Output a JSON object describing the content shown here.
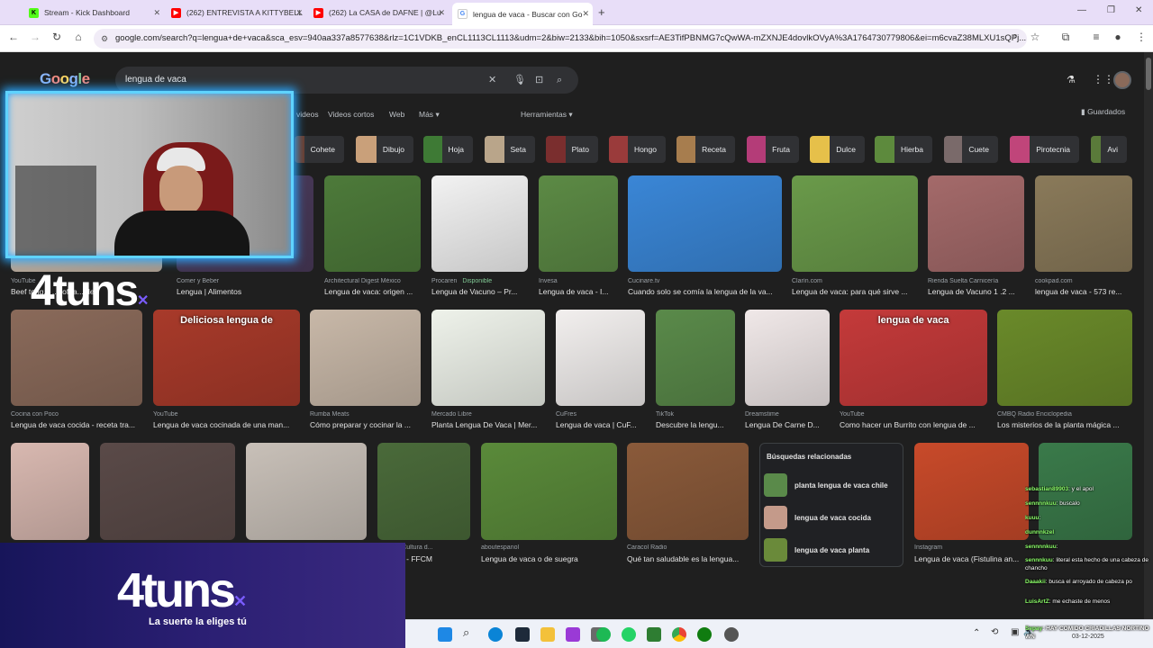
{
  "tabs": [
    {
      "label": "Stream - Kick Dashboard",
      "icon": "kick-icon",
      "color": "#53fc18"
    },
    {
      "label": "(262) ENTREVISTA A KITTYBELL",
      "icon": "youtube-icon",
      "color": "#ff0000"
    },
    {
      "label": "(262) La CASA de DAFNE | @Lu",
      "icon": "youtube-icon",
      "color": "#ff0000"
    },
    {
      "label": "lengua de vaca - Buscar con Go",
      "icon": "google-icon",
      "color": "#4285f4"
    }
  ],
  "url": "google.com/search?q=lengua+de+vaca&sca_esv=940aa337a8577638&rlz=1C1VDKB_enCL1113CL1113&udm=2&biw=2133&bih=1050&sxsrf=AE3TifPBNMG7cQwWA-mZXNJE4dovlkOVyA%3A1764730779806&ei=m6cvaZ38MLXU1sQPj...",
  "google": {
    "logo": "Google",
    "query": "lengua de vaca"
  },
  "menu": [
    "videos",
    "Videos cortos",
    "Web",
    "Más",
    "Herramientas"
  ],
  "saved": "Guardados",
  "chips": [
    {
      "label": "Cohete",
      "color": "#6b3b2a"
    },
    {
      "label": "Dibujo",
      "color": "#c9a07a"
    },
    {
      "label": "Hoja",
      "color": "#3e7a35"
    },
    {
      "label": "Seta",
      "color": "#b9a58a"
    },
    {
      "label": "Plato",
      "color": "#7a2e2e"
    },
    {
      "label": "Hongo",
      "color": "#9a3b3b"
    },
    {
      "label": "Receta",
      "color": "#a77d4e"
    },
    {
      "label": "Fruta",
      "color": "#b43c78"
    },
    {
      "label": "Dulce",
      "color": "#e6c04a"
    },
    {
      "label": "Hierba",
      "color": "#5d8a3d"
    },
    {
      "label": "Cuete",
      "color": "#7a6a6a"
    },
    {
      "label": "Pirotecnia",
      "color": "#c0457a"
    },
    {
      "label": "Avi",
      "color": "#5a7a3a"
    }
  ],
  "row1": [
    {
      "source": "YouTube",
      "caption": "Beef tong... ...soft a... de..",
      "color": "#c9b8a8"
    },
    {
      "source": "Comer y Beber",
      "caption": "Lengua | Alimentos",
      "color": "#4a3a5a"
    },
    {
      "source": "Architectural Digest México",
      "caption": "Lengua de vaca: origen ...",
      "color": "#4d7a3a"
    },
    {
      "source": "Procaren",
      "source_extra": "Disponible",
      "caption": "Lengua de Vacuno – Pr...",
      "color": "#f2f2f2"
    },
    {
      "source": "Invesa",
      "caption": "Lengua de vaca - I...",
      "color": "#5c8a45"
    },
    {
      "source": "Cucinare.tv",
      "caption": "Cuando solo se comía la lengua de la va...",
      "color": "#3a86d6"
    },
    {
      "source": "Clarín.com",
      "caption": "Lengua de vaca: para qué sirve ...",
      "color": "#6a9a4a"
    },
    {
      "source": "Rienda Suelta Carnicería",
      "caption": "Lengua de Vacuno 1 .2 ...",
      "color": "#a46a6a"
    },
    {
      "source": "cookpad.com",
      "caption": "lengua de vaca - 573 re...",
      "color": "#8a7a5a"
    }
  ],
  "row2": [
    {
      "source": "Cocina con Poco",
      "caption": "Lengua de vaca cocida - receta tra...",
      "color": "#8a6a5a"
    },
    {
      "source": "YouTube",
      "caption": "Lengua de vaca cocinada de una man...",
      "color": "#a83a2a",
      "overlay": "Deliciosa lengua de"
    },
    {
      "source": "Rumba Meats",
      "caption": "Cómo preparar y cocinar la ...",
      "color": "#c8b8a8"
    },
    {
      "source": "Mercado Libre",
      "caption": "Planta Lengua De Vaca | Mer...",
      "color": "#eef2ea"
    },
    {
      "source": "CuFres",
      "caption": "Lengua de vaca | CuF...",
      "color": "#f2efee"
    },
    {
      "source": "TikTok",
      "caption": "Descubre la lengu...",
      "color": "#5a8a4a"
    },
    {
      "source": "Dreamstime",
      "caption": "Lengua De Carne D...",
      "color": "#f0e8e8"
    },
    {
      "source": "YouTube",
      "caption": "Como hacer un Burrito con lengua de ...",
      "color": "#c43a3a",
      "overlay": "lengua de vaca"
    },
    {
      "source": "CMBQ Radio Enciclopedia",
      "caption": "Los misterios de la planta mágica ...",
      "color": "#6a8a2a"
    }
  ],
  "row3": [
    {
      "source": "",
      "caption": "",
      "color": "#d8b8b0"
    },
    {
      "source": "",
      "caption": "",
      "color": "#5a4a48"
    },
    {
      "source": "",
      "caption": "",
      "color": "#c8c0b8"
    },
    {
      "source": "Fauna y Cultura d...",
      "caption": "de vaca - FFCM",
      "color": "#4a6a3a"
    },
    {
      "source": "aboutespanol",
      "caption": "Lengua de vaca o de suegra",
      "color": "#5a8a3a"
    },
    {
      "source": "Caracol Radio",
      "caption": "Qué tan saludable es la lengua...",
      "color": "#8a5a3a"
    },
    {
      "source": "Instagram",
      "caption": "Lengua de vaca (Fistulina an...",
      "color": "#c84a2a"
    },
    {
      "source": "",
      "caption": "",
      "color": "#3a7a4a"
    }
  ],
  "related": {
    "title": "Búsquedas relacionadas",
    "items": [
      {
        "label": "planta lengua de vaca chile",
        "color": "#5a8a4a"
      },
      {
        "label": "lengua de vaca cocida",
        "color": "#c49a8a"
      },
      {
        "label": "lengua de vaca planta",
        "color": "#6a8a3a"
      }
    ]
  },
  "overlay": {
    "brand": "4tuns",
    "tagline": "La suerte la eliges tú"
  },
  "chat": [
    {
      "user": "sebastian89903",
      "text": ": y el apol"
    },
    {
      "user": "sennnnkuu",
      "text": ": buscalo"
    },
    {
      "user": "kuuu",
      "text": ":"
    },
    {
      "user": "dunnnkzel",
      "text": ""
    },
    {
      "user": "sennnnkuu",
      "text": ":"
    },
    {
      "user": "sennnkuu",
      "text": ": literal esta hecho de una cabeza de chancho"
    },
    {
      "user": "Daaakii",
      "text": ": busca el arroyado de cabeza po"
    },
    {
      "user": "LuisArtZ",
      "text": ": me echaste de menos"
    },
    {
      "user": "Sepay",
      "text": ": HAY COMIDO CRIADILLAS NORTINO WN"
    }
  ],
  "clock": {
    "date": "03-12-2025"
  }
}
